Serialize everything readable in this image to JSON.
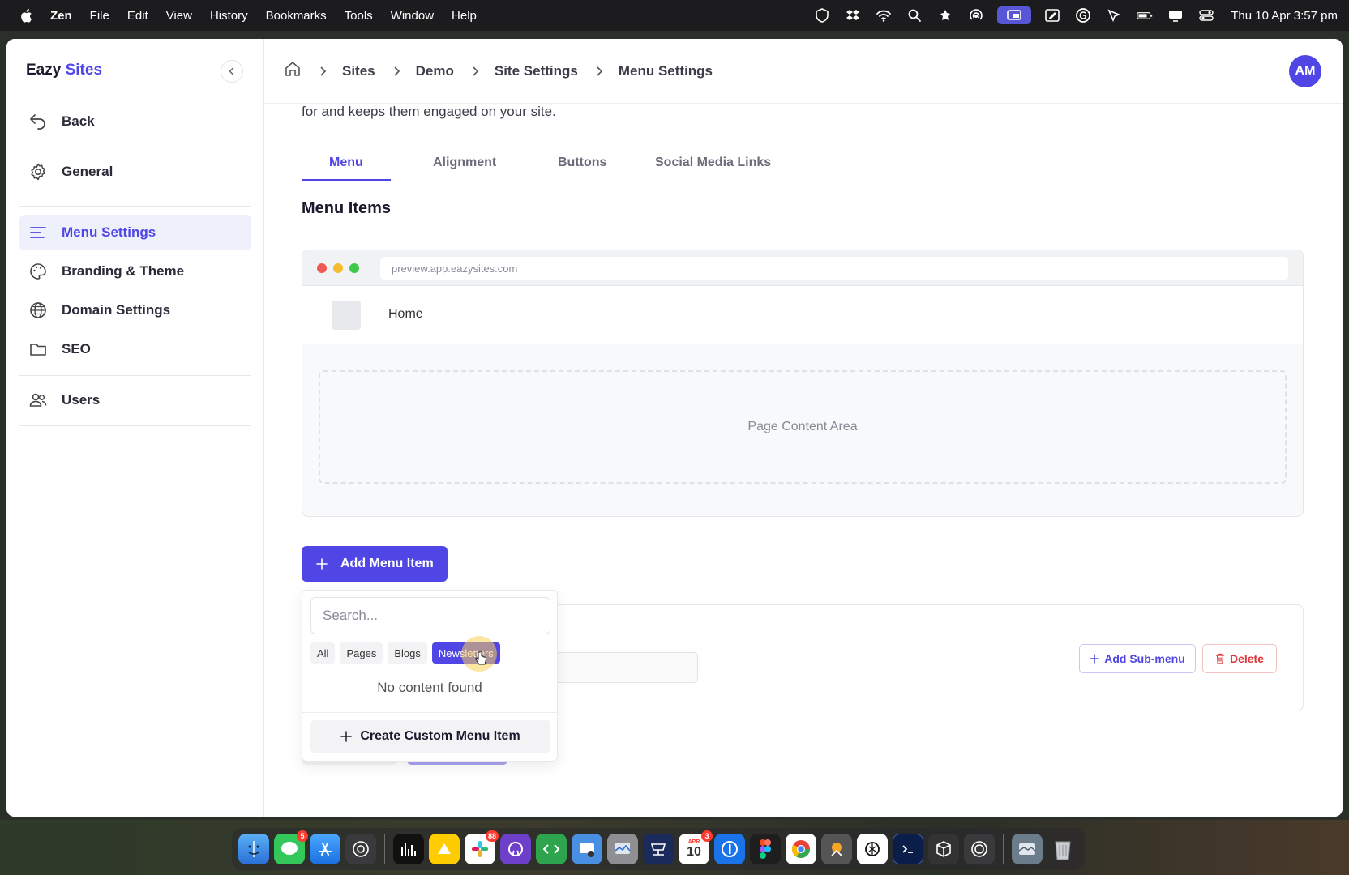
{
  "menubar": {
    "app_name": "Zen",
    "items": [
      "File",
      "Edit",
      "View",
      "History",
      "Bookmarks",
      "Tools",
      "Window",
      "Help"
    ],
    "clock": "Thu 10 Apr  3:57 pm"
  },
  "sidebar": {
    "logo_main": "Eazy",
    "logo_accent": "Sites",
    "items": [
      {
        "label": "Back",
        "icon": "back-arrow-icon"
      },
      {
        "label": "General",
        "icon": "gear-icon"
      },
      {
        "label": "Menu Settings",
        "icon": "menu-lines-icon"
      },
      {
        "label": "Branding & Theme",
        "icon": "palette-icon"
      },
      {
        "label": "Domain Settings",
        "icon": "globe-icon"
      },
      {
        "label": "SEO",
        "icon": "folder-icon"
      },
      {
        "label": "Users",
        "icon": "users-icon"
      }
    ]
  },
  "header": {
    "breadcrumbs": [
      "Sites",
      "Demo",
      "Site Settings",
      "Menu Settings"
    ],
    "avatar_initials": "AM"
  },
  "main": {
    "intro_text": "for and keeps them engaged on your site.",
    "tabs": [
      "Menu",
      "Alignment",
      "Buttons",
      "Social Media Links"
    ],
    "section_title": "Menu Items",
    "preview": {
      "url": "preview.app.eazysites.com",
      "nav_item": "Home",
      "content_area": "Page Content Area"
    },
    "add_button": "Add Menu Item",
    "menu_card": {
      "link_label": "nk",
      "link_value": "/",
      "add_submenu": "Add Sub-menu",
      "delete": "Delete"
    }
  },
  "dropdown": {
    "search_placeholder": "Search...",
    "filters": [
      "All",
      "Pages",
      "Blogs",
      "Newsletters"
    ],
    "active_filter": "Newsletters",
    "empty_text": "No content found",
    "create_button": "Create Custom Menu Item"
  },
  "colors": {
    "accent": "#4f46e5",
    "danger": "#e0353a"
  },
  "dock": {
    "badges": {
      "messages": "5",
      "slack": "88",
      "calendar": "3"
    },
    "calendar_day": "10",
    "calendar_month": "APR"
  }
}
